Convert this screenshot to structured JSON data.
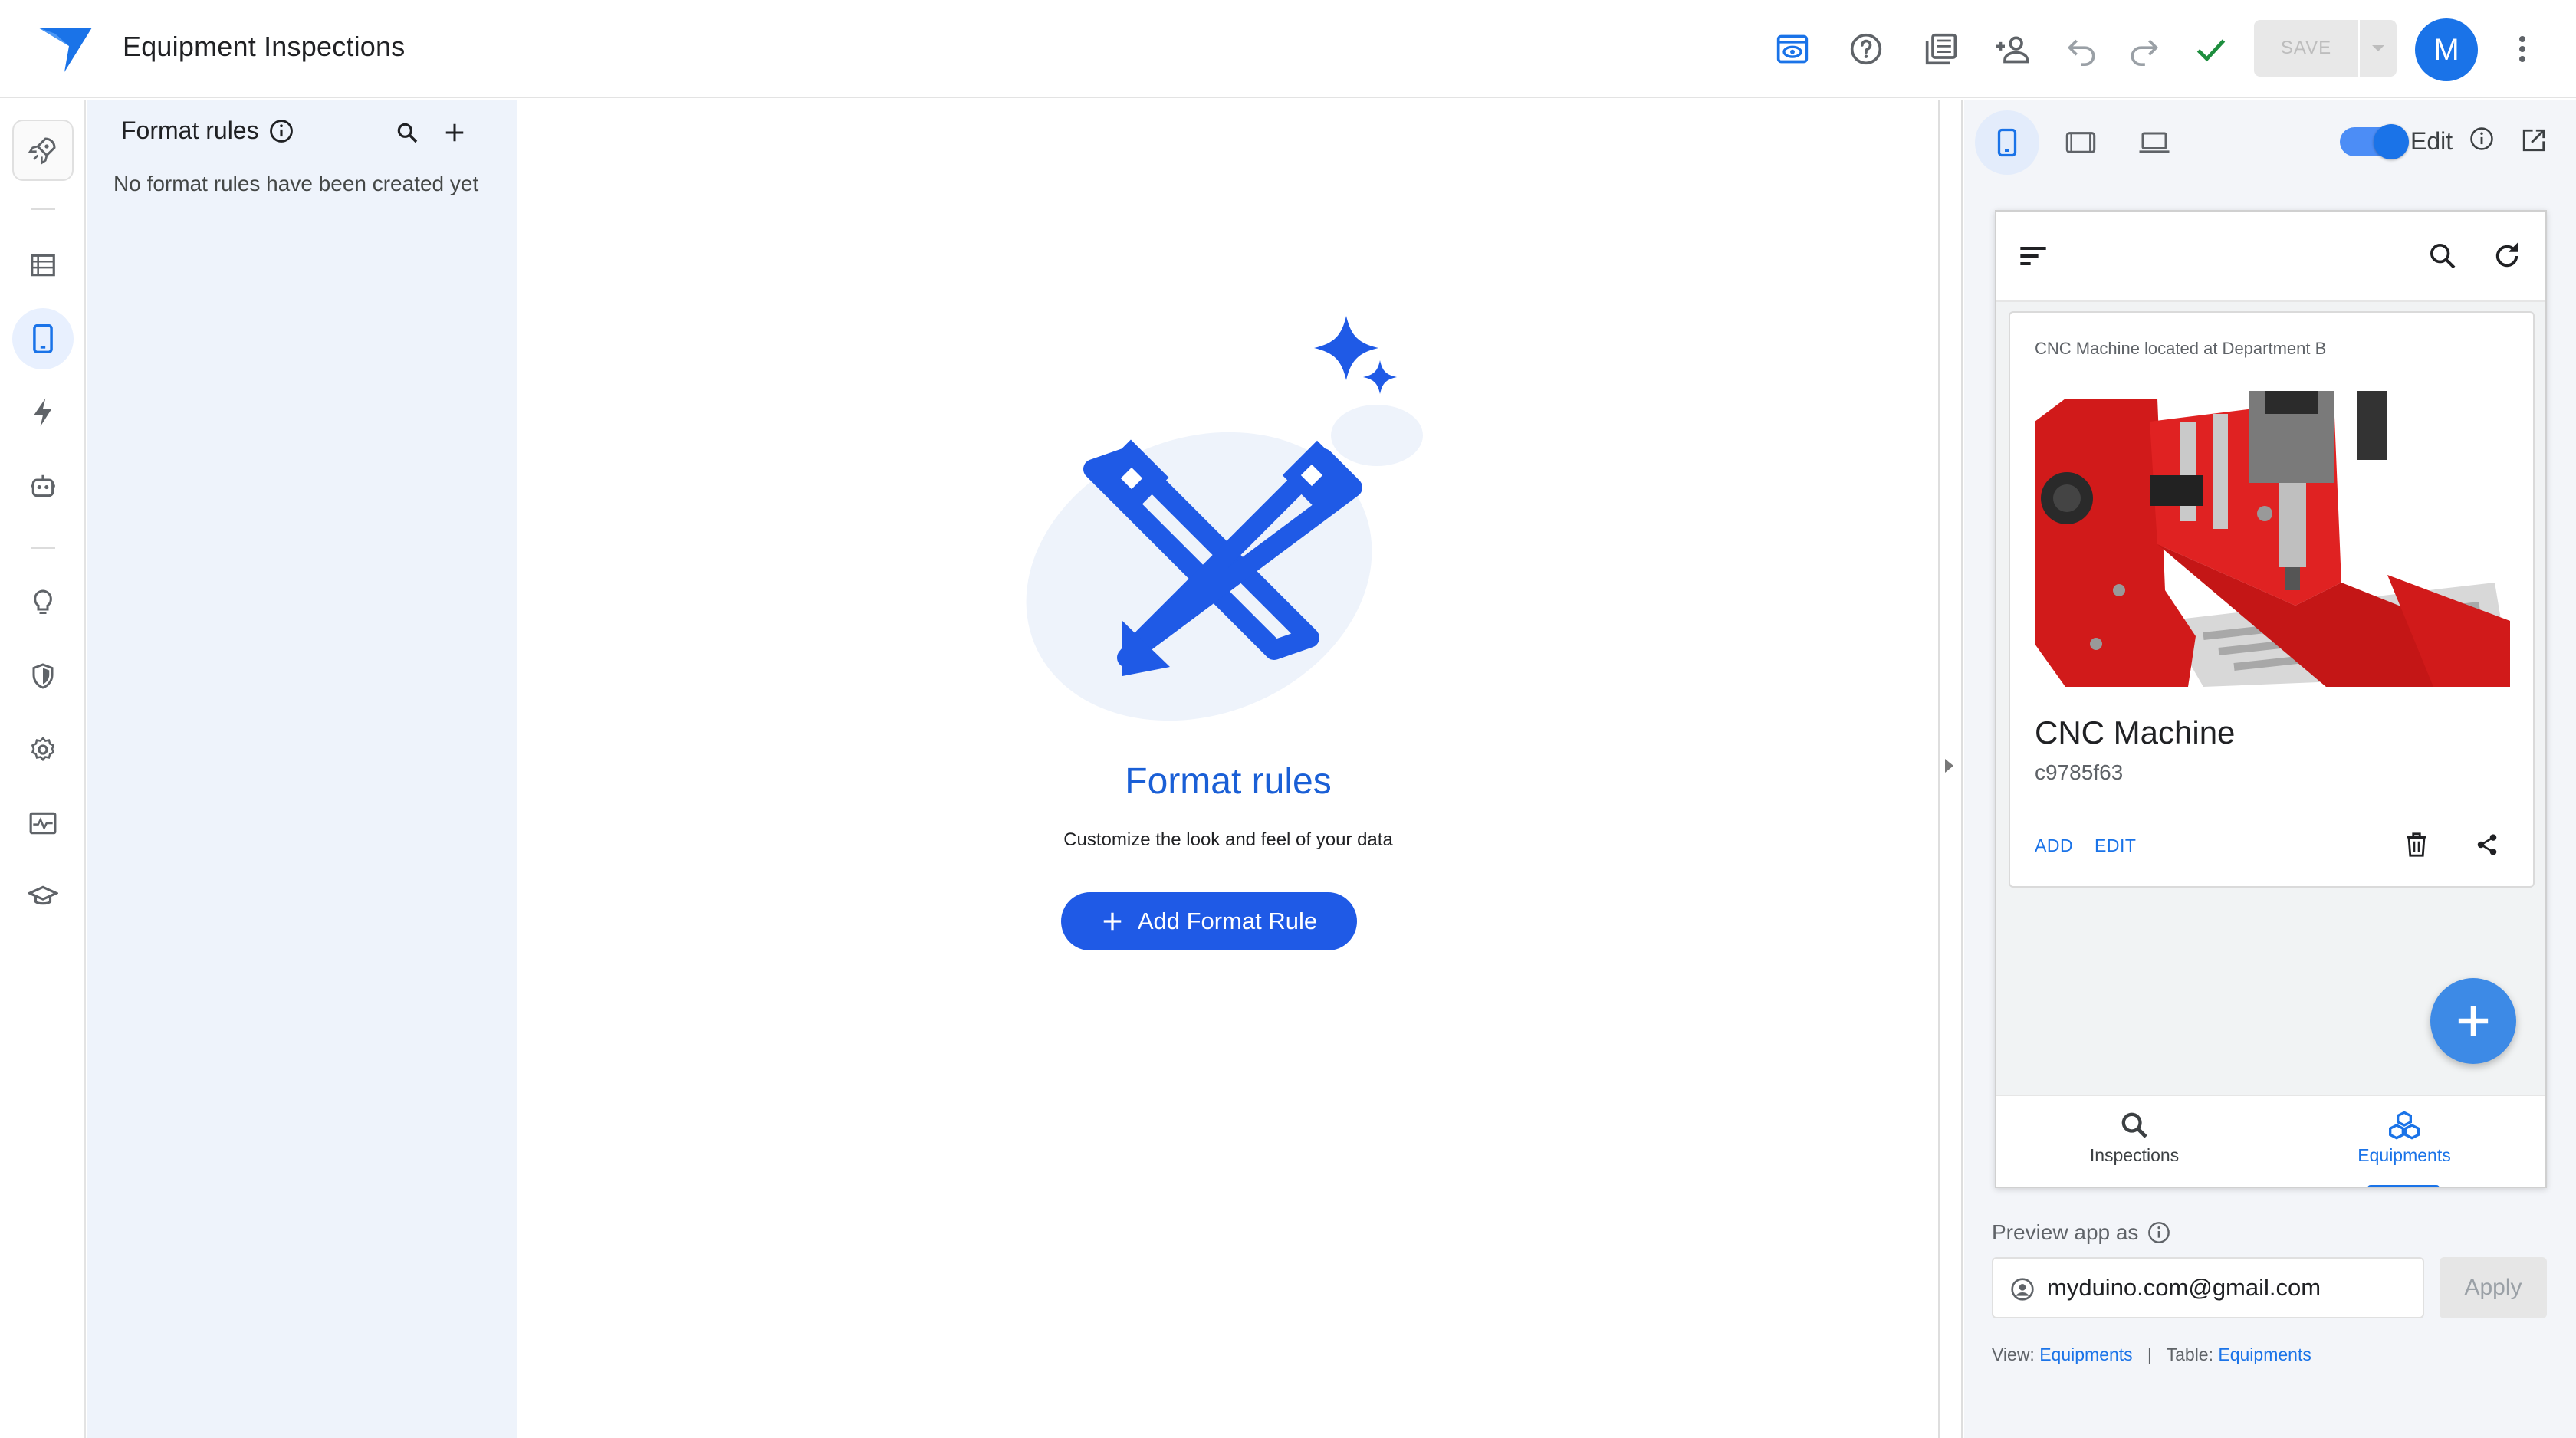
{
  "app": {
    "title": "Equipment Inspections",
    "accent_color": "#1a73e8",
    "save_label": "SAVE",
    "avatar_letter": "M"
  },
  "toolbar_icons": [
    "preview-icon",
    "help-icon",
    "gallery-icon",
    "share-user-icon",
    "undo-icon",
    "redo-icon",
    "check-icon",
    "more-vert-icon"
  ],
  "rail": {
    "items": [
      {
        "name": "rocket-icon"
      },
      {
        "name": "data-icon"
      },
      {
        "name": "views-icon",
        "active": true
      },
      {
        "name": "automation-icon"
      },
      {
        "name": "bot-icon"
      },
      {
        "name": "bulb-icon"
      },
      {
        "name": "security-icon"
      },
      {
        "name": "settings-icon"
      },
      {
        "name": "monitor-icon"
      },
      {
        "name": "learn-icon"
      }
    ]
  },
  "format_panel": {
    "title": "Format rules",
    "empty_text": "No format rules have been created yet"
  },
  "main": {
    "title": "Format rules",
    "subtitle": "Customize the look and feel of your data",
    "add_button": "Add Format Rule"
  },
  "preview": {
    "edit_label": "Edit",
    "edit_enabled": true,
    "card": {
      "caption": "CNC Machine located at Department B",
      "title": "CNC Machine",
      "id": "c9785f63",
      "add_action": "ADD",
      "edit_action": "EDIT"
    },
    "nav": [
      {
        "label": "Inspections",
        "icon": "search-icon",
        "active": false
      },
      {
        "label": "Equipments",
        "icon": "cubes-icon",
        "active": true
      }
    ],
    "preview_as_label": "Preview app as",
    "email": "myduino.com@gmail.com",
    "apply_label": "Apply",
    "footer": {
      "view_label": "View:",
      "view_value": "Equipments",
      "separator": "|",
      "table_label": "Table:",
      "table_value": "Equipments"
    }
  }
}
